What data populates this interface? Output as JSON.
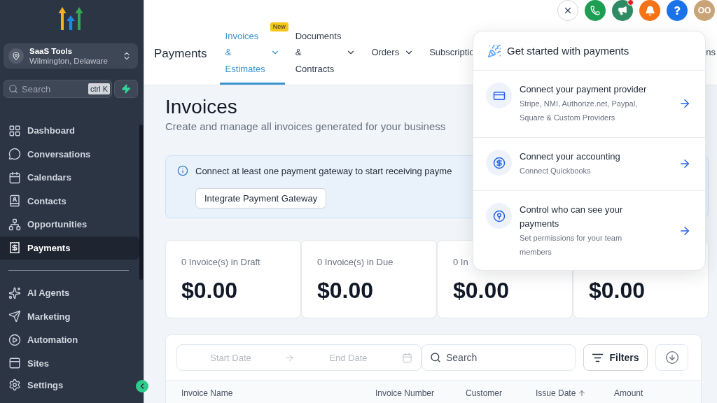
{
  "sidebar": {
    "location": {
      "name": "SaaS Tools",
      "address": "Wilmington, Delaware"
    },
    "search": {
      "placeholder": "Search",
      "shortcut": "ctrl K"
    },
    "groups": [
      {
        "items": [
          {
            "label": "Dashboard",
            "selected": false
          },
          {
            "label": "Conversations",
            "selected": false
          },
          {
            "label": "Calendars",
            "selected": false
          },
          {
            "label": "Contacts",
            "selected": false
          },
          {
            "label": "Opportunities",
            "selected": false
          },
          {
            "label": "Payments",
            "selected": true
          }
        ]
      },
      {
        "items": [
          {
            "label": "AI Agents",
            "selected": false
          },
          {
            "label": "Marketing",
            "selected": false
          },
          {
            "label": "Automation",
            "selected": false
          },
          {
            "label": "Sites",
            "selected": false
          }
        ]
      }
    ],
    "footer_item": {
      "label": "Settings",
      "selected": false
    }
  },
  "top_bar": {
    "announcements_unread": true,
    "avatar_initials": "OO"
  },
  "header": {
    "title": "Payments",
    "tabs": [
      {
        "label": "Invoices & Estimates",
        "selected": true,
        "dropdown": true,
        "badge": "New"
      },
      {
        "label": "Documents & Contracts",
        "selected": false,
        "dropdown": true
      },
      {
        "label": "Orders",
        "selected": false,
        "dropdown": true
      },
      {
        "label": "Subscriptio",
        "selected": false,
        "dropdown": false
      },
      {
        "label": "ns",
        "selected": false,
        "dropdown": false
      }
    ]
  },
  "page": {
    "title": "Invoices",
    "subtitle": "Create and manage all invoices generated for your business",
    "alert": {
      "message": "Connect at least one payment gateway to start receiving payme",
      "button": "Integrate Payment Gateway"
    },
    "stats": [
      {
        "label": "0 Invoice(s) in Draft",
        "value": "$0.00"
      },
      {
        "label": "0 Invoice(s) in Due",
        "value": "$0.00"
      },
      {
        "label": "0 In",
        "value": "$0.00"
      },
      {
        "value": "$0.00"
      }
    ],
    "table": {
      "start_placeholder": "Start Date",
      "end_placeholder": "End Date",
      "search_placeholder": "Search",
      "filters_button": "Filters",
      "columns": [
        {
          "label": "Invoice Name",
          "sorted": false
        },
        {
          "label": "Invoice Number",
          "sorted": false
        },
        {
          "label": "Customer",
          "sorted": false
        },
        {
          "label": "Issue Date",
          "sorted": true
        },
        {
          "label": "Amount",
          "sorted": false
        }
      ]
    }
  },
  "popup": {
    "title": "Get started with payments",
    "items": [
      {
        "title": "Connect your payment provider",
        "description": "Stripe, NMI, Authorize.net, Paypal, Square & Custom Providers"
      },
      {
        "title": "Connect your accounting",
        "description": "Connect Quickbooks"
      },
      {
        "title": "Control who can see your payments",
        "description": "Set permissions for your team members"
      }
    ]
  }
}
